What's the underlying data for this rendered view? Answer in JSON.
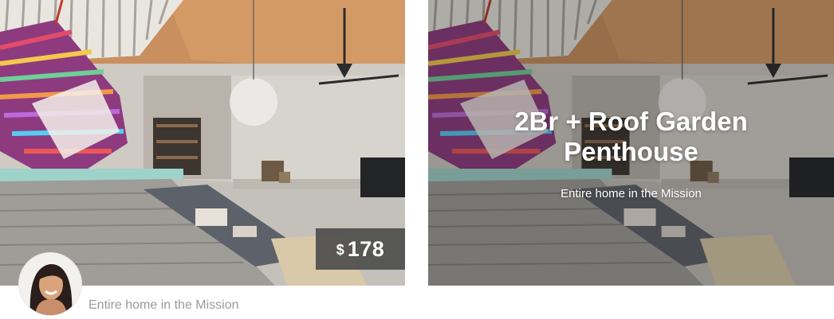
{
  "listing_card": {
    "price_currency": "$",
    "price_amount": "178",
    "subtitle": "Entire home in the Mission",
    "photo": "room-interior-hanging-chair-photo",
    "host_avatar": "host-avatar-photo"
  },
  "listing_card_hover": {
    "title": "2Br + Roof Garden Penthouse",
    "subtitle": "Entire home in the Mission",
    "photo": "room-interior-hanging-chair-photo"
  },
  "colors": {
    "price_tag_bg": "#484848",
    "subtitle_text": "#9a9a9a",
    "overlay_text": "#ffffff"
  }
}
